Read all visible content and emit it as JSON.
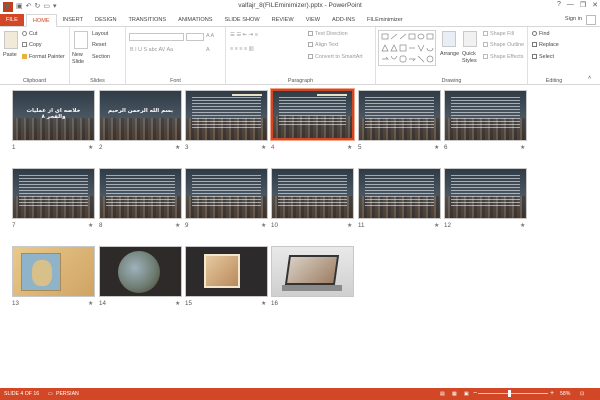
{
  "window": {
    "title": "valfajr_8(FILEminimizer).pptx - PowerPoint",
    "app_logo": "P",
    "controls": [
      "?",
      "—",
      "❐",
      "✕"
    ]
  },
  "tabs": [
    {
      "label": "FILE"
    },
    {
      "label": "HOME",
      "active": true
    },
    {
      "label": "INSERT"
    },
    {
      "label": "DESIGN"
    },
    {
      "label": "TRANSITIONS"
    },
    {
      "label": "ANIMATIONS"
    },
    {
      "label": "SLIDE SHOW"
    },
    {
      "label": "REVIEW"
    },
    {
      "label": "VIEW"
    },
    {
      "label": "ADD-INS"
    },
    {
      "label": "FILEminimizer"
    }
  ],
  "signin": "Sign in",
  "ribbon": {
    "clipboard": {
      "label": "Clipboard",
      "paste": "Paste",
      "cut": "Cut",
      "copy": "Copy",
      "format_painter": "Format Painter"
    },
    "slides": {
      "label": "Slides",
      "new_slide": "New Slide",
      "layout": "Layout",
      "reset": "Reset",
      "section": "Section"
    },
    "font": {
      "label": "Font"
    },
    "paragraph": {
      "label": "Paragraph",
      "text_direction": "Text Direction",
      "align_text": "Align Text",
      "convert": "Convert to SmartArt"
    },
    "drawing": {
      "label": "Drawing",
      "arrange": "Arrange",
      "quick_styles": "Quick Styles",
      "shape_fill": "Shape Fill",
      "shape_outline": "Shape Outline",
      "shape_effects": "Shape Effects"
    },
    "editing": {
      "label": "Editing",
      "find": "Find",
      "replace": "Replace",
      "select": "Select"
    }
  },
  "slides": [
    {
      "num": "1",
      "title": "خلاصه ای از عملیات والفجر ۸",
      "kind": "title"
    },
    {
      "num": "2",
      "title": "بسم الله الرحمن الرحیم",
      "kind": "title"
    },
    {
      "num": "3",
      "title": "",
      "kind": "text"
    },
    {
      "num": "4",
      "title": "",
      "kind": "text",
      "selected": true
    },
    {
      "num": "5",
      "title": "",
      "kind": "text"
    },
    {
      "num": "6",
      "title": "",
      "kind": "text"
    },
    {
      "num": "7",
      "title": "",
      "kind": "text"
    },
    {
      "num": "8",
      "title": "",
      "kind": "text"
    },
    {
      "num": "9",
      "title": "",
      "kind": "text"
    },
    {
      "num": "10",
      "title": "",
      "kind": "text"
    },
    {
      "num": "11",
      "title": "",
      "kind": "text"
    },
    {
      "num": "12",
      "title": "",
      "kind": "text"
    },
    {
      "num": "13",
      "title": "",
      "kind": "map"
    },
    {
      "num": "14",
      "title": "",
      "kind": "circle"
    },
    {
      "num": "15",
      "title": "",
      "kind": "painting"
    },
    {
      "num": "16",
      "title": "",
      "kind": "laptop"
    }
  ],
  "star_glyph": "★",
  "status": {
    "slide_info": "SLIDE 4 OF 16",
    "language": "PERSIAN",
    "zoom": "58%",
    "zoom_minus": "−",
    "zoom_plus": "+"
  }
}
